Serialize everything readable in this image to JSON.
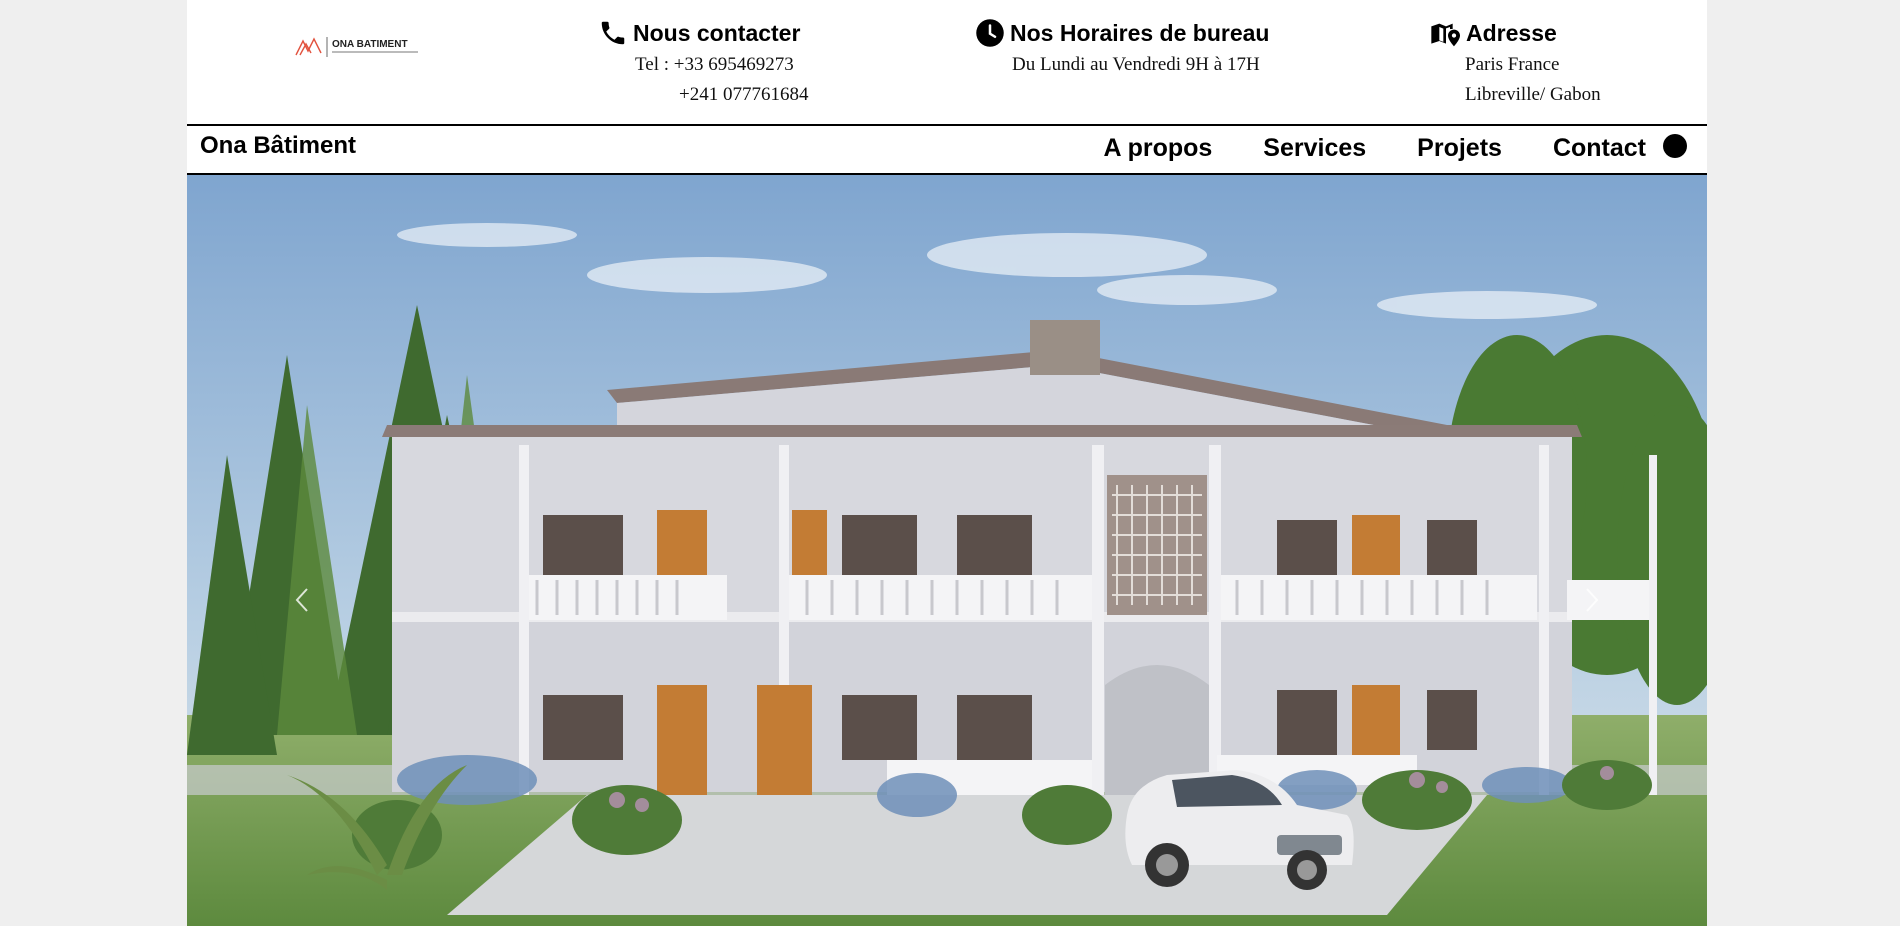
{
  "logo": {
    "text": "ONA BATIMENT",
    "tagline": "BÂTIMENT & CONSTRUCTION"
  },
  "contact": {
    "title": "Nous contacter",
    "icon": "phone-icon",
    "line1": "Tel : +33 695469273",
    "line2": "+241 077761684"
  },
  "hours": {
    "title": "Nos Horaires de bureau",
    "icon": "clock-icon",
    "line1": "Du Lundi au Vendredi 9H à 17H"
  },
  "address": {
    "title": "Adresse",
    "icon": "map-marker-icon",
    "line1": "Paris France",
    "line2": "Libreville/ Gabon"
  },
  "nav": {
    "brand": "Ona Bâtiment",
    "items": [
      {
        "label": "A propos"
      },
      {
        "label": "Services"
      },
      {
        "label": "Projets"
      },
      {
        "label": "Contact"
      }
    ]
  },
  "hero": {
    "image": "two-storey-building-render",
    "prev_icon": "chevron-left-icon",
    "next_icon": "chevron-right-icon"
  },
  "colors": {
    "page_bg": "#efefef",
    "content_bg": "#ffffff",
    "logo_accent": "#e2533f",
    "text": "#000000"
  }
}
